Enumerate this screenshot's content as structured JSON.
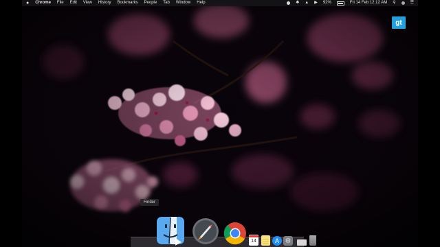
{
  "menubar": {
    "apple_icon": "apple-icon",
    "app_name": "Chrome",
    "menus": [
      "File",
      "Edit",
      "View",
      "History",
      "Bookmarks",
      "People",
      "Tab",
      "Window",
      "Help"
    ],
    "battery_percent": "92%",
    "datetime": "Fri 14 Feb  12:12 AM"
  },
  "badge": {
    "text": "gt",
    "color": "#23a0dc"
  },
  "dock": {
    "tooltip": "Finder",
    "calendar_day": "14",
    "items": [
      "finder-icon",
      "launchpad-icon",
      "chrome-icon",
      "calendar-icon",
      "notes-icon",
      "app-store-icon",
      "system-preferences-icon",
      "downloads-icon",
      "trash-icon"
    ]
  }
}
